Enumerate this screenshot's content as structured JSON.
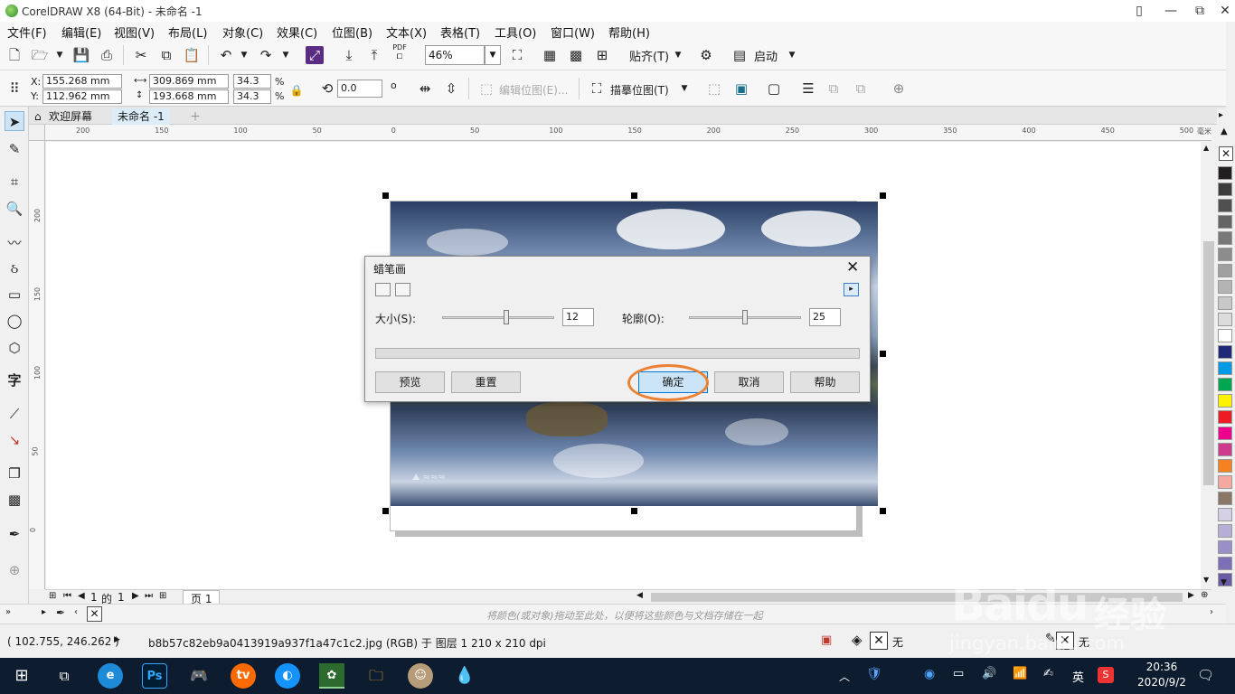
{
  "window": {
    "title": "CorelDRAW X8 (64-Bit) - 未命名 -1",
    "min": "—",
    "max": "❐",
    "close": "✕",
    "restore_icon": "⧉"
  },
  "menu": [
    "文件(F)",
    "编辑(E)",
    "视图(V)",
    "布局(L)",
    "对象(C)",
    "效果(C)",
    "位图(B)",
    "文本(X)",
    "表格(T)",
    "工具(O)",
    "窗口(W)",
    "帮助(H)"
  ],
  "toolbar1": {
    "zoom": "46%",
    "snap": "贴齐(T)",
    "launch": "启动",
    "pdf": "PDF"
  },
  "property_bar": {
    "x_label": "X:",
    "x": "155.268 mm",
    "y_label": "Y:",
    "y": "112.962 mm",
    "w": "309.869 mm",
    "h": "193.668 mm",
    "sx": "34.3",
    "sy": "34.3",
    "pct": "%",
    "rotation": "0.0",
    "deg": "o",
    "edit_bitmap": "编辑位图(E)...",
    "trace_bitmap": "描摹位图(T)"
  },
  "doc_tabs": [
    {
      "label": "欢迎屏幕"
    },
    {
      "label": "未命名 -1"
    }
  ],
  "ruler_h": [
    "200",
    "150",
    "100",
    "50",
    "0",
    "50",
    "100",
    "150",
    "200",
    "250",
    "300",
    "350",
    "400",
    "450",
    "500"
  ],
  "ruler_h_unit": "毫米",
  "ruler_v": [
    "200",
    "150",
    "100",
    "50",
    "0"
  ],
  "dialog": {
    "title": "蜡笔画",
    "size_label": "大小(S):",
    "size_value": "12",
    "size_level": 0.58,
    "outline_label": "轮廓(O):",
    "outline_value": "25",
    "outline_level": 0.5,
    "buttons": {
      "preview": "预览",
      "reset": "重置",
      "ok": "确定",
      "cancel": "取消",
      "help": "帮助"
    }
  },
  "page_nav": {
    "current": "1",
    "of": "的",
    "total": "1",
    "page_tab": "页 1"
  },
  "doc_palette_hint": "将颜色(或对象)拖动至此处，以便将这些颜色与文档存储在一起",
  "status": {
    "coords": "( 102.755, 246.262 )",
    "info": "b8b57c82eb9a0413919a937f1a47c1c2.jpg (RGB) 于 图层 1 210 x 210 dpi",
    "fill": "无",
    "outline": "无"
  },
  "palette_colors": [
    "#231f20",
    "#3c3c3c",
    "#505050",
    "#646464",
    "#787878",
    "#8c8c8c",
    "#a0a0a0",
    "#b4b4b4",
    "#c8c8c8",
    "#dcdcdc",
    "#ffffff",
    "#1e2a78",
    "#0099e6",
    "#00a650",
    "#fff200",
    "#ed1c24",
    "#ec008c",
    "#cf3b8c",
    "#f58220",
    "#f3a8a0",
    "#8b7765",
    "#d6d0e6",
    "#b7aed6",
    "#9b8fc8",
    "#7e70b8",
    "#6a5aa8"
  ],
  "taskbar": {
    "time": "20:36",
    "date": "2020/9/2",
    "ime": "英",
    "apps": [
      "start",
      "task-view",
      "ie",
      "photoshop",
      "game",
      "media",
      "browser",
      "coreldraw",
      "explorer",
      "photo",
      "paint"
    ]
  },
  "watermark": {
    "brand": "Baidu",
    "cn": "经验",
    "url": "jingyan.baidu.com"
  },
  "colors": {
    "accent": "#ec8033",
    "ok_button": "#cce4f7",
    "taskbar": "#0d1c2e"
  }
}
